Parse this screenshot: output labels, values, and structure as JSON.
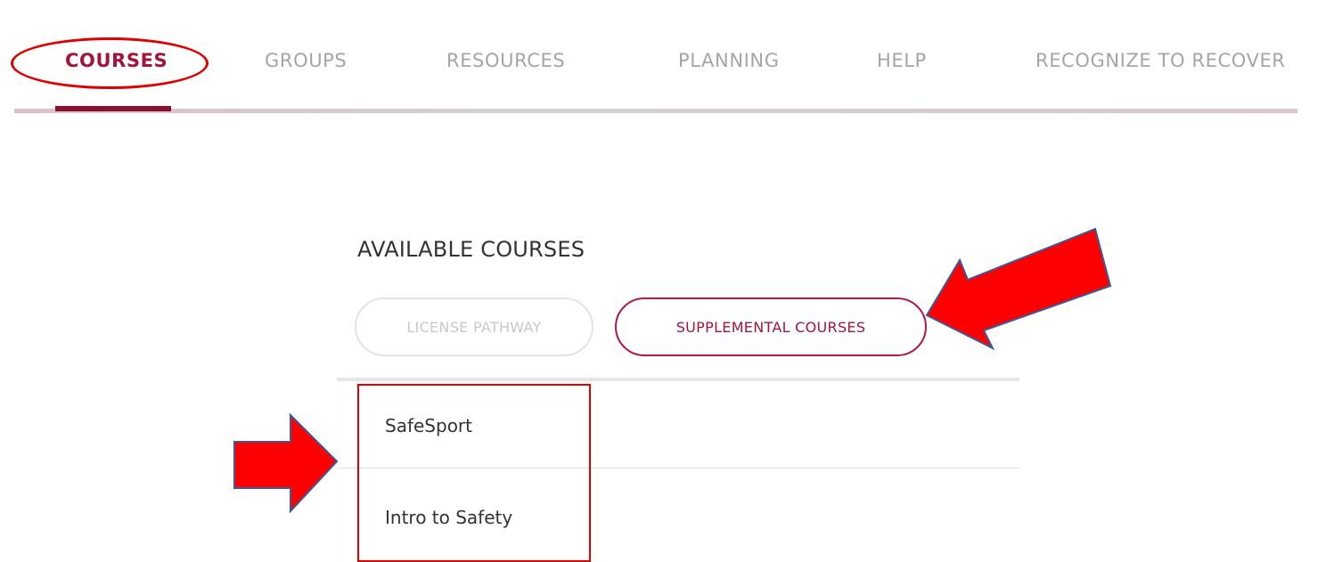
{
  "nav": {
    "items": [
      {
        "label": "COURSES",
        "active": true
      },
      {
        "label": "GROUPS",
        "active": false
      },
      {
        "label": "RESOURCES",
        "active": false
      },
      {
        "label": "PLANNING",
        "active": false
      },
      {
        "label": "HELP",
        "active": false
      },
      {
        "label": "RECOGNIZE TO RECOVER",
        "active": false
      }
    ]
  },
  "courses": {
    "title": "AVAILABLE COURSES",
    "tabs": [
      {
        "label": "LICENSE PATHWAY",
        "active": false
      },
      {
        "label": "SUPPLEMENTAL COURSES",
        "active": true
      }
    ],
    "items": [
      {
        "label": "SafeSport"
      },
      {
        "label": "Intro to Safety"
      }
    ]
  },
  "annotations": {
    "color": "#e10000",
    "arrow_fill": "#ff0000",
    "arrow_stroke": "#3a5a9a",
    "shapes": [
      "ellipse",
      "rectangle",
      "arrow",
      "arrow"
    ]
  },
  "colors": {
    "accent": "#a3143a",
    "inactive_text": "#a5a5a5",
    "body_text": "#333333"
  }
}
